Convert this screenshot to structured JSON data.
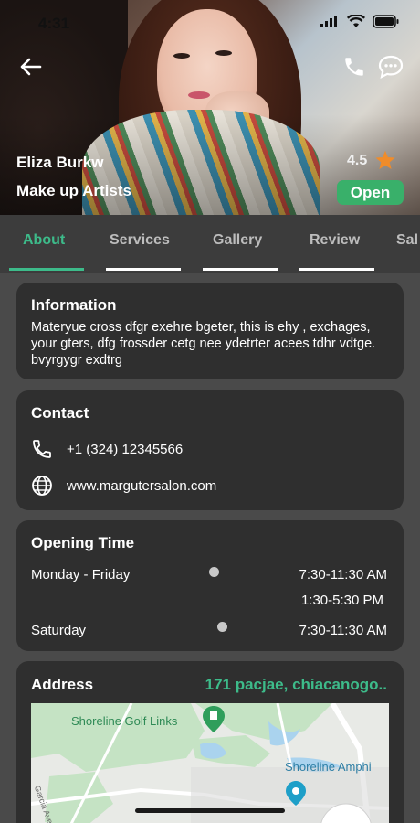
{
  "status": {
    "time": "4:31"
  },
  "profile": {
    "name": "Eliza Burkw",
    "category": "Make up Artists",
    "rating": "4.5",
    "open_label": "Open"
  },
  "tabs": [
    {
      "label": "About",
      "active": true
    },
    {
      "label": "Services",
      "active": false
    },
    {
      "label": "Gallery",
      "active": false
    },
    {
      "label": "Review",
      "active": false
    },
    {
      "label": "Sal",
      "active": false
    }
  ],
  "information": {
    "title": "Information",
    "text": "Materyue cross dfgr exehre bgeter, this is ehy , exchages, your gters, dfg frossder cetg nee ydetrter acees tdhr vdtge. bvyrgygr exdtrg"
  },
  "contact": {
    "title": "Contact",
    "phone": "+1 (324) 12345566",
    "website": "www.margutersalon.com"
  },
  "opening": {
    "title": "Opening Time",
    "rows": [
      {
        "day": "Monday - Friday",
        "times": [
          "7:30-11:30 AM",
          "1:30-5:30 PM"
        ]
      },
      {
        "day": "Saturday",
        "times": [
          "7:30-11:30 AM"
        ]
      }
    ]
  },
  "address": {
    "title": "Address",
    "value": "171 pacjae, chiacanogo..",
    "map": {
      "label_golf": "Shoreline Golf Links",
      "label_amphi": "Shoreline Amphi",
      "label_street": "Garcia Ave"
    }
  },
  "colors": {
    "accent": "#3dbb8a",
    "open_badge": "#39b06a",
    "card": "#2f2f2f",
    "background": "#4a4a4a",
    "star": "#f08c2a"
  }
}
